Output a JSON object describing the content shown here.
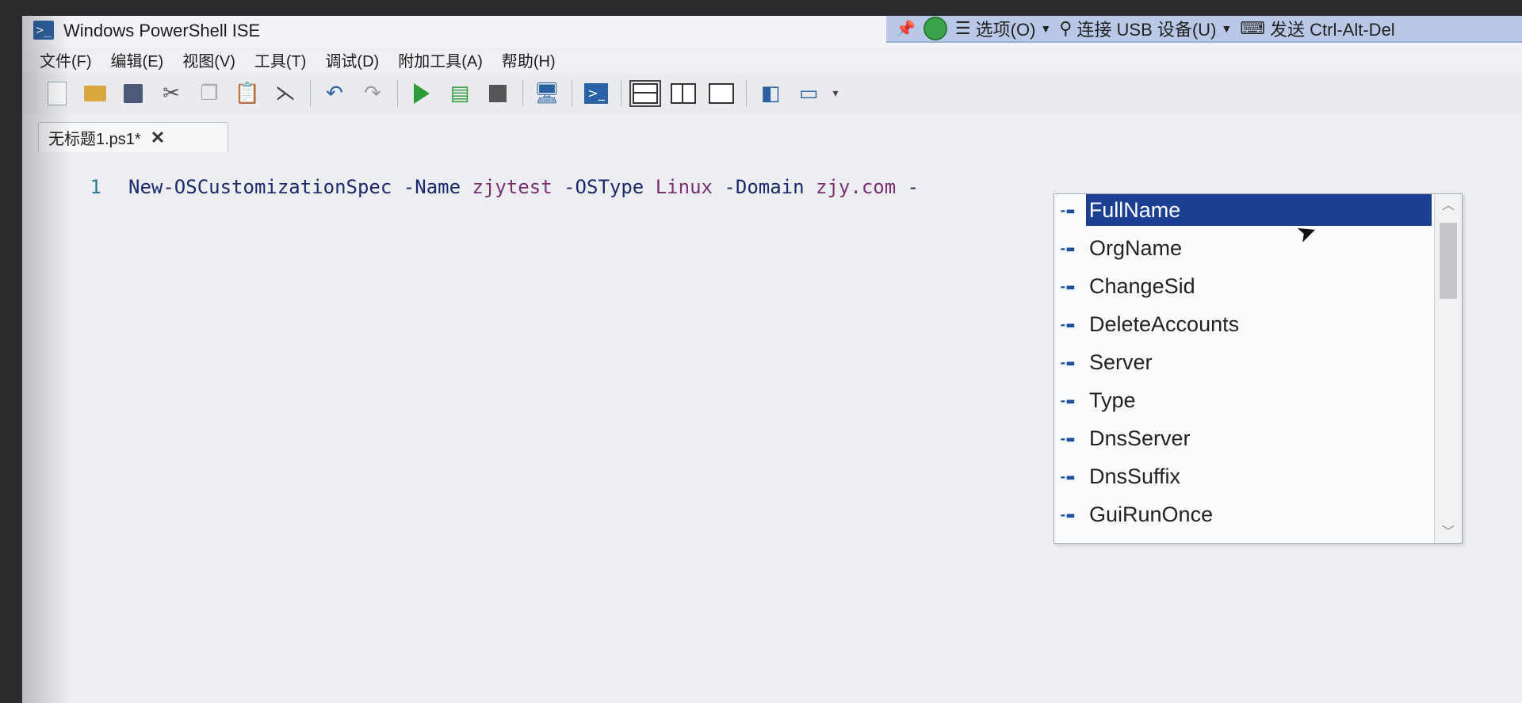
{
  "window": {
    "title": "Windows PowerShell ISE",
    "icon": "powershell-icon"
  },
  "remote_bar": {
    "options_label": "选项(O)",
    "connect_usb_label": "连接 USB 设备(U)",
    "send_label": "发送 Ctrl-Alt-Del"
  },
  "menu": {
    "items": [
      "文件(F)",
      "编辑(E)",
      "视图(V)",
      "工具(T)",
      "调试(D)",
      "附加工具(A)",
      "帮助(H)"
    ]
  },
  "toolbar": {
    "icons": [
      "new-icon",
      "open-icon",
      "save-icon",
      "cut-icon",
      "copy-icon",
      "paste-icon",
      "clear-icon",
      "undo-icon",
      "redo-icon",
      "run-icon",
      "run-selection-icon",
      "stop-icon",
      "remote-powershell-icon",
      "powershell-console-icon",
      "show-script-pane-top-icon",
      "show-script-pane-right-icon",
      "show-script-pane-max-icon",
      "show-command-pane-icon",
      "show-addon-icon"
    ]
  },
  "tab": {
    "label": "无标题1.ps1*",
    "close": "✕"
  },
  "editor": {
    "line_number": "1",
    "code": {
      "cmdlet": "New-OSCustomizationSpec",
      "p1": "-Name",
      "a1": "zjytest",
      "p2": "-OSType",
      "a2": "Linux",
      "p3": "-Domain",
      "a3": "zjy.com",
      "p4": "-"
    }
  },
  "intellisense": {
    "items": [
      "FullName",
      "OrgName",
      "ChangeSid",
      "DeleteAccounts",
      "Server",
      "Type",
      "DnsServer",
      "DnsSuffix",
      "GuiRunOnce"
    ],
    "selected": "FullName",
    "item_icon": "parameter-icon"
  }
}
